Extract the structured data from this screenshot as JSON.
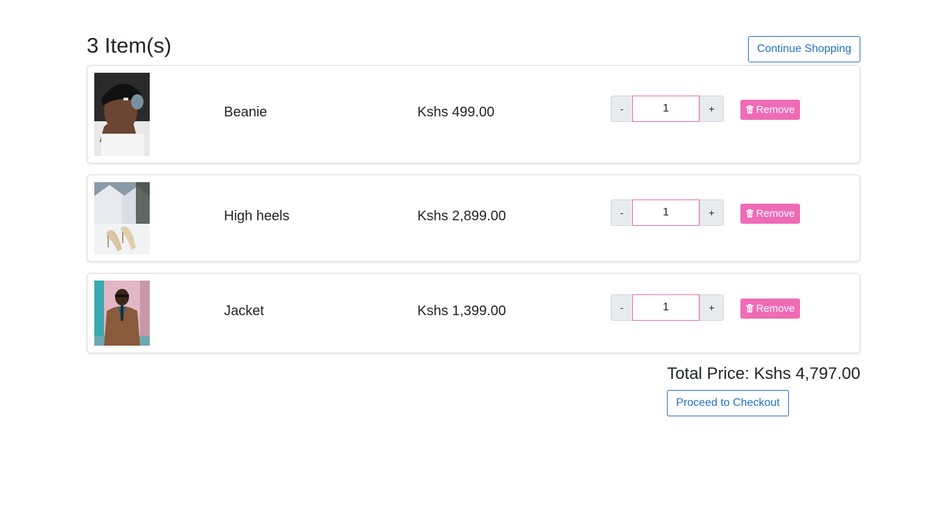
{
  "header": {
    "title": "3 Item(s)",
    "continue_label": "Continue Shopping"
  },
  "cart": {
    "items": [
      {
        "name": "Beanie",
        "price": "Kshs 499.00",
        "quantity": "1",
        "minus_label": "-",
        "plus_label": "+",
        "remove_label": "Remove",
        "image_icon": "beanie-photo"
      },
      {
        "name": "High heels",
        "price": "Kshs 2,899.00",
        "quantity": "1",
        "minus_label": "-",
        "plus_label": "+",
        "remove_label": "Remove",
        "image_icon": "heels-photo"
      },
      {
        "name": "Jacket",
        "price": "Kshs 1,399.00",
        "quantity": "1",
        "minus_label": "-",
        "plus_label": "+",
        "remove_label": "Remove",
        "image_icon": "jacket-photo"
      }
    ]
  },
  "summary": {
    "total": "Total Price: Kshs 4,797.00",
    "checkout_label": "Proceed to Checkout"
  },
  "colors": {
    "accent_blue": "#1f6fc8",
    "remove_pink": "#f06bb5",
    "input_border_pink": "#e76fb2"
  }
}
